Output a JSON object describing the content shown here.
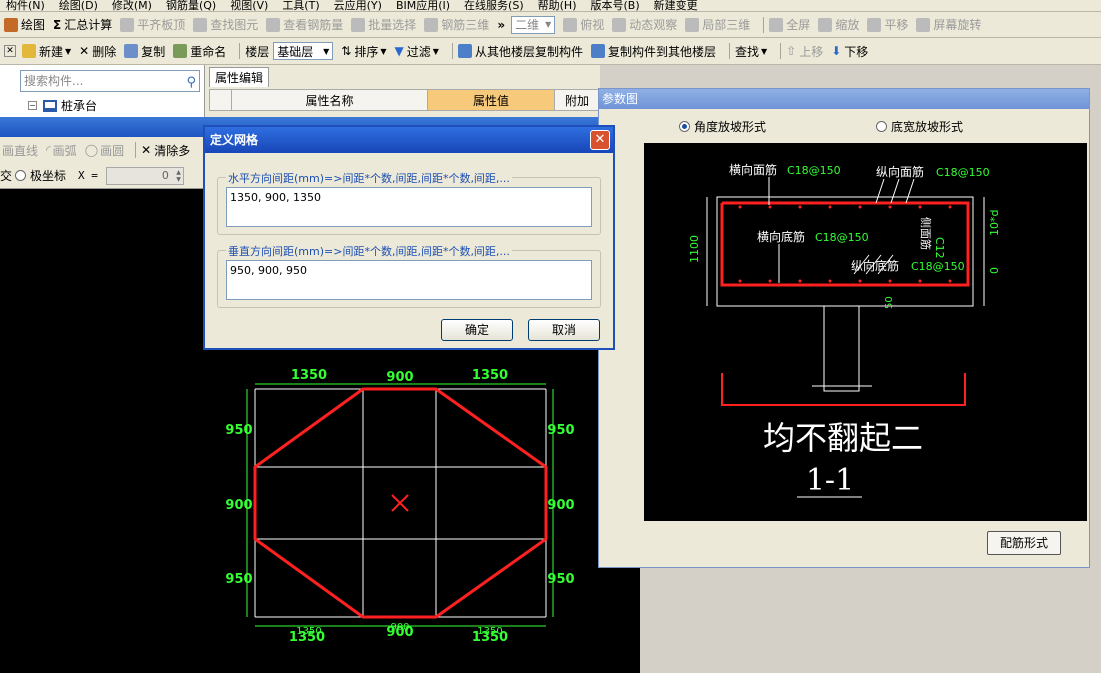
{
  "menubar": [
    "构件(N)",
    "绘图(D)",
    "修改(M)",
    "钢筋量(Q)",
    "视图(V)",
    "工具(T)",
    "云应用(Y)",
    "BIM应用(I)",
    "在线服务(S)",
    "帮助(H)",
    "版本号(B)",
    "新建变更"
  ],
  "toolbar1": {
    "draw": "绘图",
    "summary": "汇总计算",
    "flat_slab": "平齐板顶",
    "find_elem": "查找图元",
    "view_rebar": "查看钢筋量",
    "batch_select": "批量选择",
    "rebar_3d": "钢筋三维",
    "view_mode": "二维",
    "top_view": "俯视",
    "dynamic": "动态观察",
    "local_3d": "局部三维",
    "fullscreen": "全屏",
    "zoom": "缩放",
    "pan": "平移",
    "rotate": "屏幕旋转"
  },
  "toolbar2": {
    "new": "新建",
    "delete": "删除",
    "copy": "复制",
    "rename": "重命名",
    "floor_label": "楼层",
    "floor_value": "基础层",
    "sort": "排序",
    "filter": "过滤",
    "copy_from": "从其他楼层复制构件",
    "copy_to": "复制构件到其他楼层",
    "find": "查找",
    "move_up": "上移",
    "move_down": "下移"
  },
  "left_panel": {
    "search_placeholder": "搜索构件...",
    "tree_item": "桩承台"
  },
  "prop_panel": {
    "tab": "属性编辑",
    "col_name": "属性名称",
    "col_value": "属性值",
    "col_extra": "附加"
  },
  "draw_window": {
    "tools": [
      "画直线",
      "画弧",
      "画圆",
      "清除多"
    ],
    "coord_label": "极坐标",
    "x_label": "X =",
    "x_value": "0"
  },
  "grid_labels": {
    "top": [
      "1350",
      "900",
      "1350"
    ],
    "bottom": [
      "1350",
      "900",
      "1350"
    ],
    "bottom_small": [
      "1350",
      "900",
      "1350"
    ],
    "left": [
      "950",
      "900",
      "950"
    ],
    "right": [
      "950",
      "900",
      "950"
    ]
  },
  "dialog": {
    "title": "定义网格",
    "h_label": "水平方向间距(mm)=>间距*个数,间距,间距*个数,间距,...",
    "h_value": "1350, 900, 1350",
    "v_label": "垂直方向间距(mm)=>间距*个数,间距,间距*个数,间距,...",
    "v_value": "950, 900, 950",
    "ok": "确定",
    "cancel": "取消"
  },
  "param_window": {
    "title": "参数图",
    "opt_angle": "角度放坡形式",
    "opt_width": "底宽放坡形式",
    "config_button": "配筋形式",
    "labels": {
      "top_h": "横向面筋",
      "top_h_val": "C18@150",
      "top_v": "纵向面筋",
      "top_v_val": "C18@150",
      "bot_h": "横向底筋",
      "bot_h_val": "C18@150",
      "bot_v": "纵向底筋",
      "bot_v_val": "C18@150",
      "side": "侧面筋",
      "side_val": "C12",
      "height": "1100",
      "ten_d": "10*d",
      "zero": "0",
      "fifty": "50",
      "caption": "均不翻起二",
      "section": "1-1"
    }
  },
  "colors": {
    "grid": "#ffffff",
    "shape": "#ff2020",
    "label": "#33ff33",
    "rebar": "#33ff33"
  }
}
